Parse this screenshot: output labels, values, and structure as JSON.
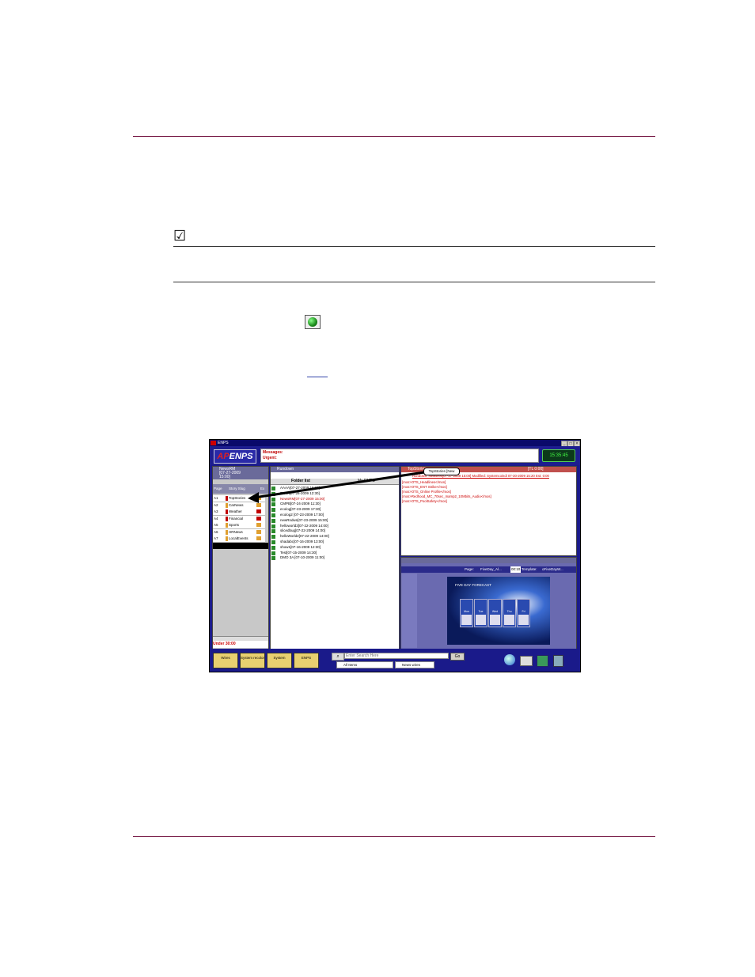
{
  "page": {
    "checkmark_symbol": "☑",
    "link_underline": "",
    "accent_color": "#7a1f4a"
  },
  "screenshot": {
    "window_title": "ENPS",
    "logo_text": "ENPS",
    "logo_prefix": "AP",
    "messages_label": "Messages:",
    "urgent_label": "Urgent:",
    "clock": "15:35:45",
    "rundown_panel": {
      "title_top": "NewsRM",
      "title_date": "[07-27-2009",
      "title_time": "15:00]",
      "col_page": "Page",
      "col_slug": "Story Slug",
      "col_extra": "Ex",
      "rows": [
        {
          "page": "A1",
          "slug": "TopStories",
          "mark": "#c00000",
          "icon": "#e0a030"
        },
        {
          "page": "A2",
          "slug": "CarNews",
          "mark": "#e0a030",
          "icon": "#e0a030"
        },
        {
          "page": "A3",
          "slug": "Weather",
          "mark": "#c00000",
          "icon": "#c00000"
        },
        {
          "page": "A4",
          "slug": "Financial",
          "mark": "#c00000",
          "icon": "#c00000"
        },
        {
          "page": "A5",
          "slug": "Sports",
          "mark": "#e0a030",
          "icon": "#e0a030"
        },
        {
          "page": "A6",
          "slug": "HRNews",
          "mark": "#e0a030",
          "icon": "#e0a030"
        },
        {
          "page": "A7",
          "slug": "LocalEvents",
          "mark": "#e0a030",
          "icon": "#e0a030"
        }
      ],
      "footer": "Under 30:00"
    },
    "list_panel": {
      "title": "Rundown",
      "header_folder": "Folder list",
      "header_enps": "My ENPS",
      "items": [
        {
          "text": "AAAA[07-27-2009 15:00]",
          "red": false
        },
        {
          "text": "BLAH[07-28-2009 12:30]",
          "red": false
        },
        {
          "text": "NewsRM[07-27-2009 15:00]",
          "red": true
        },
        {
          "text": "CMPB[07-24-2009 11:30]",
          "red": false
        },
        {
          "text": "ecolog[07-23-2009 17:30]",
          "red": false
        },
        {
          "text": "ecolog2 [07-23-2009 17:00]",
          "red": false
        },
        {
          "text": "newRndwn[07-23-2009 15:00]",
          "red": false
        },
        {
          "text": "helloworld3[07-22-2009 14:00]",
          "red": false
        },
        {
          "text": "slicedbug[07-22-2009 14:00]",
          "red": false
        },
        {
          "text": "helloWorld2[07-22-2009 14:00]",
          "red": false
        },
        {
          "text": "shadabc[07-16-2009 13:00]",
          "red": false
        },
        {
          "text": "show1[07-16-2009 12:30]",
          "red": false
        },
        {
          "text": "Test[07-15-2009 14:30]",
          "red": false
        },
        {
          "text": "DMO 3A [07-10-2009 11:00]",
          "red": false
        }
      ]
    },
    "story_panel": {
      "title": "TopStories",
      "timer": "[TL 0:00]",
      "callout": "TopStories [New",
      "meta": "Rundown: NewsRM[07-27-2009 15:00]  Modified: Systemcoindi   07-30-2009 15:20  Est: 0:00",
      "lines": [
        "[mos>OTS_Headlines</mos]",
        "[mos>OTS_ENT Strike</mos]",
        "[mos>OTS_Online Profile</mos]",
        "[mos>Redhood_MC_70sec_mamp2_10Mbits_Audio</mos]",
        "[mos>OTS_PoolSafety</mos]"
      ]
    },
    "template_panel": {
      "page_label": "Page:",
      "page_value": "FiveDay_Al...",
      "page_num": "00:10",
      "template_label": "Template:",
      "template_value": "oFiveDayW...",
      "forecast_title": "FIVE DAY FORECAST",
      "days": [
        "Mon",
        "Tue",
        "Wed",
        "Thu",
        "Fri"
      ]
    },
    "taskbar": {
      "buttons": [
        "Wires",
        "System recolor",
        "System",
        "ENPS"
      ],
      "search_placeholder": "Enter Search Here",
      "go_label": "Go",
      "scope_value": "All Items",
      "wires_label": "News wires"
    }
  }
}
